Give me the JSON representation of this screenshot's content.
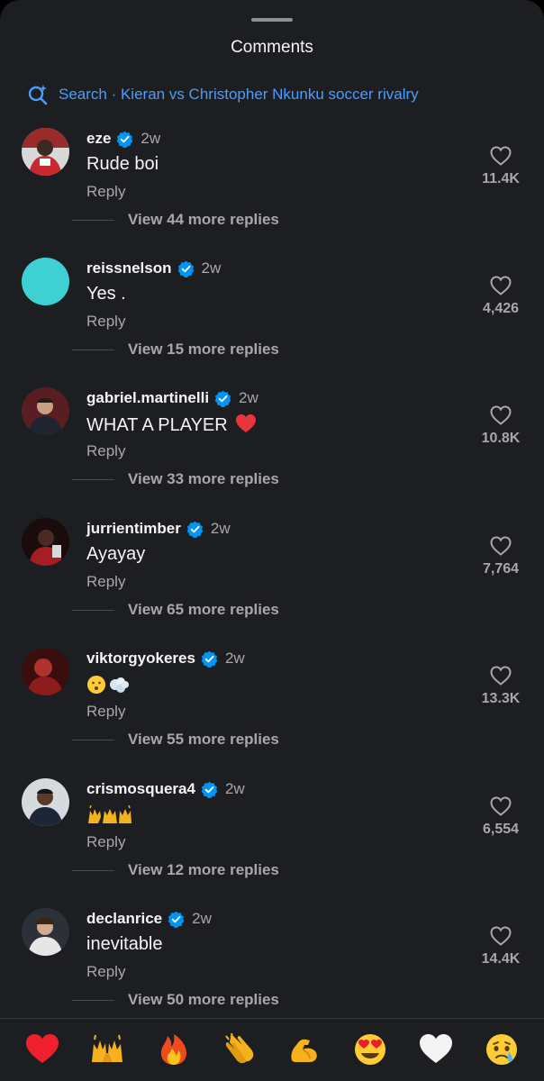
{
  "header": {
    "title": "Comments"
  },
  "search": {
    "text": "Search · Kieran vs Christopher Nkunku soccer rivalry"
  },
  "comments": [
    {
      "username": "eze",
      "time": "2w",
      "text": "Rude boi",
      "reply": "Reply",
      "likes": "11.4K",
      "more": "View 44 more replies",
      "avatar_color": "#b33a3a"
    },
    {
      "username": "reissnelson",
      "time": "2w",
      "text": "Yes .",
      "reply": "Reply",
      "likes": "4,426",
      "more": "View 15 more replies",
      "avatar_color": "#3fd0d4"
    },
    {
      "username": "gabriel.martinelli",
      "time": "2w",
      "text": "WHAT A PLAYER",
      "emoji": "red-heart-emoji",
      "reply": "Reply",
      "likes": "10.8K",
      "more": "View 33 more replies",
      "avatar_color": "#7a2a2a"
    },
    {
      "username": "jurrientimber",
      "time": "2w",
      "text": "Ayayay",
      "reply": "Reply",
      "likes": "7,764",
      "more": "View 65 more replies",
      "avatar_color": "#3a1414"
    },
    {
      "username": "viktorgyokeres",
      "time": "2w",
      "text": "",
      "emoji": "face-exhaling-emoji",
      "reply": "Reply",
      "likes": "13.3K",
      "more": "View 55 more replies",
      "avatar_color": "#6a1e1e"
    },
    {
      "username": "crismosquera4",
      "time": "2w",
      "text": "",
      "emoji": "raising-hands-emoji",
      "reply": "Reply",
      "likes": "6,554",
      "more": "View 12 more replies",
      "avatar_color": "#cfd2d6"
    },
    {
      "username": "declanrice",
      "time": "2w",
      "text": "inevitable",
      "reply": "Reply",
      "likes": "14.4K",
      "more": "View 50 more replies",
      "avatar_color": "#30353c"
    }
  ],
  "emoji_bar": [
    "red-heart-emoji",
    "raising-hands-emoji",
    "fire-emoji",
    "clapping-hands-emoji",
    "flexed-biceps-emoji",
    "heart-eyes-emoji",
    "white-heart-emoji",
    "crying-face-emoji"
  ],
  "colors": {
    "background": "#1c1e22",
    "accent": "#4a9dff",
    "verified": "#0095f6",
    "secondary_text": "#a8a8ab"
  }
}
